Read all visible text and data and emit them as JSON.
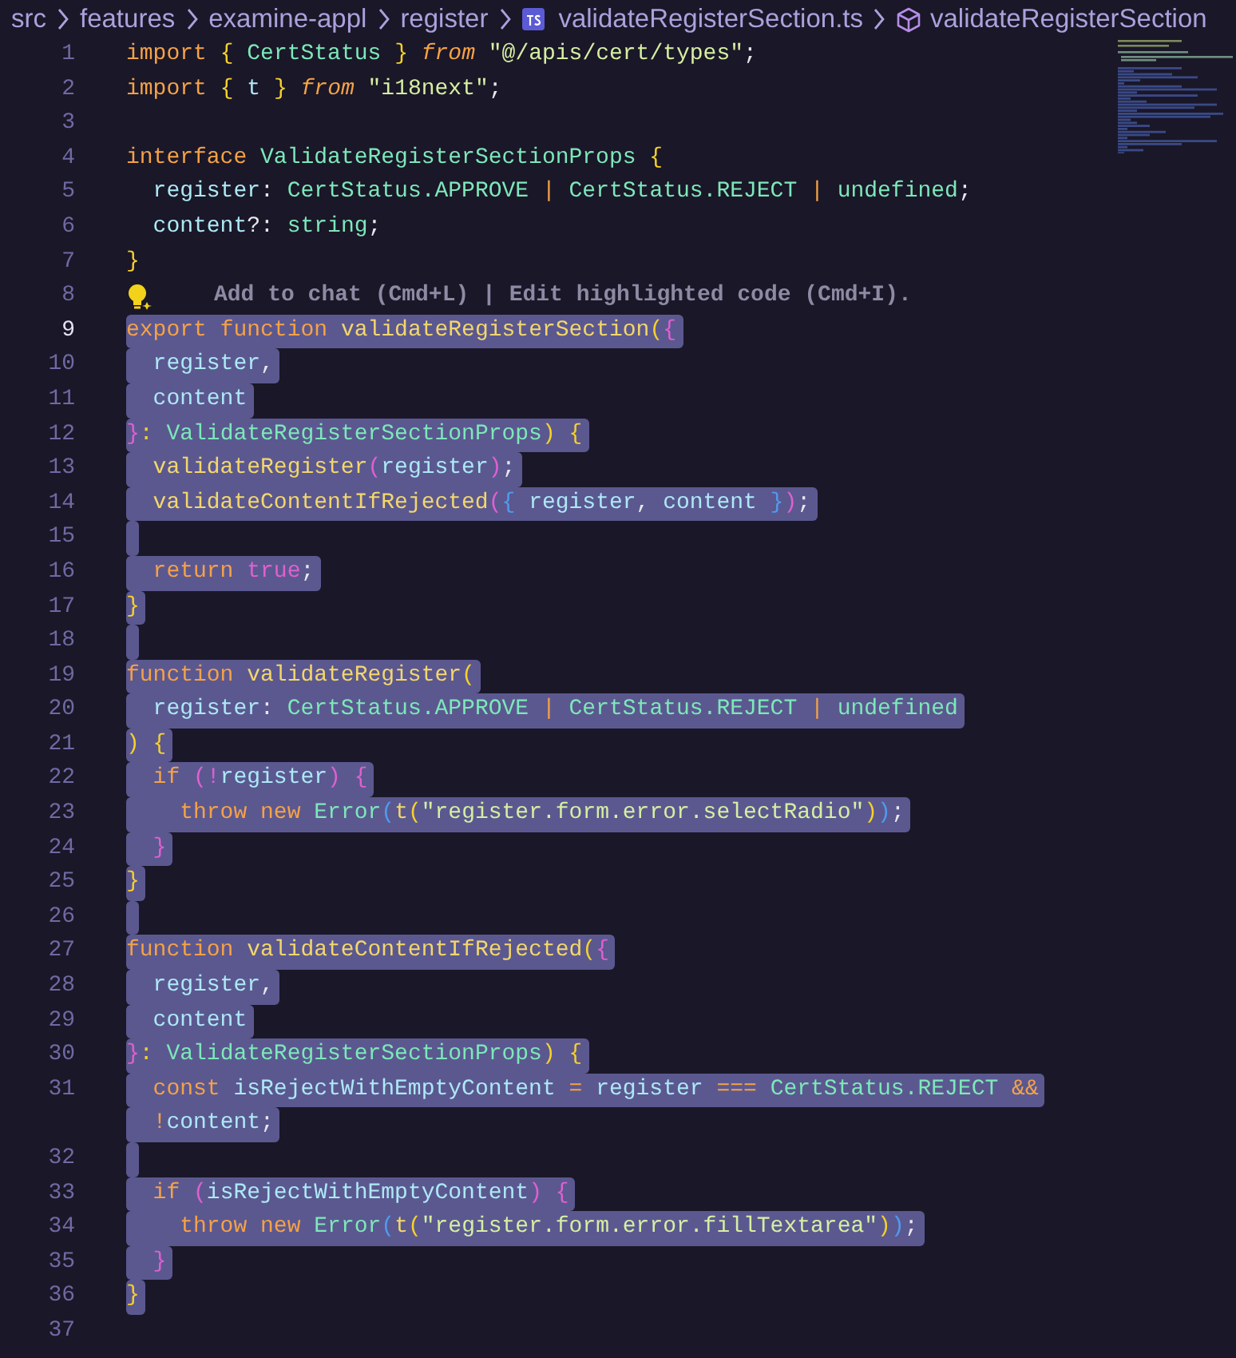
{
  "breadcrumb": [
    {
      "label": "src",
      "kind": "folder"
    },
    {
      "label": "features",
      "kind": "folder"
    },
    {
      "label": "examine-appl",
      "kind": "folder"
    },
    {
      "label": "register",
      "kind": "folder"
    },
    {
      "label": "validateRegisterSection.ts",
      "kind": "file"
    },
    {
      "label": "validateRegisterSection",
      "kind": "symbol"
    }
  ],
  "lines": [
    {
      "number": "1",
      "selected": false,
      "tokens": [
        {
          "t": "import",
          "kind": "kw"
        },
        {
          "t": " {",
          "kind": "b"
        },
        {
          "t": " CertStatus ",
          "kind": "ty"
        },
        {
          "t": "} ",
          "kind": "b"
        },
        {
          "t": "from",
          "kind": "ki"
        },
        {
          "t": " \"@/apis/cert/types\"",
          "kind": "s"
        },
        {
          "t": ";",
          "kind": "p"
        }
      ]
    },
    {
      "number": "2",
      "selected": false,
      "tokens": [
        {
          "t": "import",
          "kind": "kw"
        },
        {
          "t": " { ",
          "kind": "b"
        },
        {
          "t": "t",
          "kind": "v"
        },
        {
          "t": " } ",
          "kind": "b"
        },
        {
          "t": "from",
          "kind": "ki"
        },
        {
          "t": " \"i18next\"",
          "kind": "s"
        },
        {
          "t": ";",
          "kind": "p"
        }
      ]
    },
    {
      "number": "3",
      "selected": false
    },
    {
      "number": "4",
      "selected": false,
      "tokens": [
        {
          "t": "interface",
          "kind": "kw"
        },
        {
          "t": " ValidateRegisterSectionProps",
          "kind": "ty"
        },
        {
          "t": " {",
          "kind": "b"
        }
      ]
    },
    {
      "number": "5",
      "selected": false,
      "tokens": [
        {
          "t": "  register",
          "kind": "v"
        },
        {
          "t": ": ",
          "kind": "p"
        },
        {
          "t": "CertStatus.APPROVE",
          "kind": "ty"
        },
        {
          "t": " | ",
          "kind": "o"
        },
        {
          "t": "CertStatus.REJECT",
          "kind": "ty"
        },
        {
          "t": " | ",
          "kind": "o"
        },
        {
          "t": "undefined",
          "kind": "ty"
        },
        {
          "t": ";",
          "kind": "p"
        }
      ]
    },
    {
      "number": "6",
      "selected": false,
      "tokens": [
        {
          "t": "  content",
          "kind": "v"
        },
        {
          "t": "?: ",
          "kind": "p"
        },
        {
          "t": "string",
          "kind": "ty"
        },
        {
          "t": ";",
          "kind": "p"
        }
      ]
    },
    {
      "number": "7",
      "selected": false,
      "tokens": [
        {
          "t": "}",
          "kind": "b"
        }
      ]
    },
    {
      "number": "8",
      "selected": false,
      "hint": "Add to chat (Cmd+L) | Edit highlighted code (Cmd+I)."
    },
    {
      "number": "9",
      "selected": true,
      "tokens": [
        {
          "t": "export",
          "kind": "kw"
        },
        {
          "t": " function",
          "kind": "kw"
        },
        {
          "t": " validateRegisterSection",
          "kind": "f"
        },
        {
          "t": "(",
          "kind": "b"
        },
        {
          "t": "{",
          "kind": "m"
        }
      ]
    },
    {
      "number": "10",
      "selected": true,
      "tokens": [
        {
          "t": "  register",
          "kind": "v"
        },
        {
          "t": ",",
          "kind": "p"
        }
      ]
    },
    {
      "number": "11",
      "selected": true,
      "tokens": [
        {
          "t": "  content",
          "kind": "v"
        }
      ]
    },
    {
      "number": "12",
      "selected": true,
      "tokens": [
        {
          "t": "}",
          "kind": "m"
        },
        {
          "t": ": ",
          "kind": "b"
        },
        {
          "t": "ValidateRegisterSectionProps",
          "kind": "ty"
        },
        {
          "t": ")",
          "kind": "b"
        },
        {
          "t": " {",
          "kind": "b"
        }
      ]
    },
    {
      "number": "13",
      "selected": true,
      "tokens": [
        {
          "t": "  validateRegister",
          "kind": "f"
        },
        {
          "t": "(",
          "kind": "m"
        },
        {
          "t": "register",
          "kind": "v"
        },
        {
          "t": ")",
          "kind": "m"
        },
        {
          "t": ";",
          "kind": "p"
        }
      ]
    },
    {
      "number": "14",
      "selected": true,
      "tokens": [
        {
          "t": "  validateContentIfRejected",
          "kind": "f"
        },
        {
          "t": "(",
          "kind": "m"
        },
        {
          "t": "{ ",
          "kind": "bl"
        },
        {
          "t": "register",
          "kind": "v"
        },
        {
          "t": ", ",
          "kind": "p"
        },
        {
          "t": "content",
          "kind": "v"
        },
        {
          "t": " }",
          "kind": "bl"
        },
        {
          "t": ")",
          "kind": "m"
        },
        {
          "t": ";",
          "kind": "p"
        }
      ]
    },
    {
      "number": "15",
      "selected": true
    },
    {
      "number": "16",
      "selected": true,
      "tokens": [
        {
          "t": "  return",
          "kind": "kw"
        },
        {
          "t": " true",
          "kind": "m"
        },
        {
          "t": ";",
          "kind": "p"
        }
      ]
    },
    {
      "number": "17",
      "selected": true,
      "tokens": [
        {
          "t": "}",
          "kind": "b"
        }
      ]
    },
    {
      "number": "18",
      "selected": true
    },
    {
      "number": "19",
      "selected": true,
      "tokens": [
        {
          "t": "function",
          "kind": "kw"
        },
        {
          "t": " validateRegister",
          "kind": "f"
        },
        {
          "t": "(",
          "kind": "b"
        }
      ]
    },
    {
      "number": "20",
      "selected": true,
      "tokens": [
        {
          "t": "  register",
          "kind": "v"
        },
        {
          "t": ": ",
          "kind": "p"
        },
        {
          "t": "CertStatus.APPROVE",
          "kind": "ty"
        },
        {
          "t": " | ",
          "kind": "o"
        },
        {
          "t": "CertStatus.REJECT",
          "kind": "ty"
        },
        {
          "t": " | ",
          "kind": "o"
        },
        {
          "t": "undefined",
          "kind": "ty"
        }
      ]
    },
    {
      "number": "21",
      "selected": true,
      "tokens": [
        {
          "t": ")",
          "kind": "b"
        },
        {
          "t": " {",
          "kind": "b"
        }
      ]
    },
    {
      "number": "22",
      "selected": true,
      "tokens": [
        {
          "t": "  if",
          "kind": "kw"
        },
        {
          "t": " (!",
          "kind": "m"
        },
        {
          "t": "register",
          "kind": "v"
        },
        {
          "t": ")",
          "kind": "m"
        },
        {
          "t": " {",
          "kind": "m"
        }
      ]
    },
    {
      "number": "23",
      "selected": true,
      "tokens": [
        {
          "t": "    throw",
          "kind": "kw"
        },
        {
          "t": " new",
          "kind": "kw"
        },
        {
          "t": " Error",
          "kind": "ty"
        },
        {
          "t": "(",
          "kind": "bl"
        },
        {
          "t": "t",
          "kind": "f"
        },
        {
          "t": "(",
          "kind": "b"
        },
        {
          "t": "\"register.form.error.selectRadio\"",
          "kind": "s"
        },
        {
          "t": ")",
          "kind": "b"
        },
        {
          "t": ")",
          "kind": "bl"
        },
        {
          "t": ";",
          "kind": "p"
        }
      ]
    },
    {
      "number": "24",
      "selected": true,
      "tokens": [
        {
          "t": "  }",
          "kind": "m"
        }
      ]
    },
    {
      "number": "25",
      "selected": true,
      "tokens": [
        {
          "t": "}",
          "kind": "b"
        }
      ]
    },
    {
      "number": "26",
      "selected": true
    },
    {
      "number": "27",
      "selected": true,
      "tokens": [
        {
          "t": "function",
          "kind": "kw"
        },
        {
          "t": " validateContentIfRejected",
          "kind": "f"
        },
        {
          "t": "(",
          "kind": "b"
        },
        {
          "t": "{",
          "kind": "m"
        }
      ]
    },
    {
      "number": "28",
      "selected": true,
      "tokens": [
        {
          "t": "  register",
          "kind": "v"
        },
        {
          "t": ",",
          "kind": "p"
        }
      ]
    },
    {
      "number": "29",
      "selected": true,
      "tokens": [
        {
          "t": "  content",
          "kind": "v"
        }
      ]
    },
    {
      "number": "30",
      "selected": true,
      "tokens": [
        {
          "t": "}",
          "kind": "m"
        },
        {
          "t": ": ",
          "kind": "b"
        },
        {
          "t": "ValidateRegisterSectionProps",
          "kind": "ty"
        },
        {
          "t": ")",
          "kind": "b"
        },
        {
          "t": " {",
          "kind": "b"
        }
      ]
    },
    {
      "number": "31",
      "selected": true,
      "tokens": [
        {
          "t": "  const",
          "kind": "kw"
        },
        {
          "t": " isRejectWithEmptyContent",
          "kind": "v"
        },
        {
          "t": " = ",
          "kind": "o"
        },
        {
          "t": "register",
          "kind": "v"
        },
        {
          "t": " === ",
          "kind": "o"
        },
        {
          "t": "CertStatus.REJECT",
          "kind": "ty"
        },
        {
          "t": " &&",
          "kind": "o"
        }
      ],
      "wrapped": [
        {
          "t": "  !",
          "kind": "o"
        },
        {
          "t": "content",
          "kind": "v"
        },
        {
          "t": ";",
          "kind": "p"
        }
      ]
    },
    {
      "number": "32",
      "selected": true
    },
    {
      "number": "33",
      "selected": true,
      "tokens": [
        {
          "t": "  if",
          "kind": "kw"
        },
        {
          "t": " (",
          "kind": "m"
        },
        {
          "t": "isRejectWithEmptyContent",
          "kind": "v"
        },
        {
          "t": ")",
          "kind": "m"
        },
        {
          "t": " {",
          "kind": "m"
        }
      ]
    },
    {
      "number": "34",
      "selected": true,
      "tokens": [
        {
          "t": "    throw",
          "kind": "kw"
        },
        {
          "t": " new",
          "kind": "kw"
        },
        {
          "t": " Error",
          "kind": "ty"
        },
        {
          "t": "(",
          "kind": "bl"
        },
        {
          "t": "t",
          "kind": "f"
        },
        {
          "t": "(",
          "kind": "b"
        },
        {
          "t": "\"register.form.error.fillTextarea\"",
          "kind": "s"
        },
        {
          "t": ")",
          "kind": "b"
        },
        {
          "t": ")",
          "kind": "bl"
        },
        {
          "t": ";",
          "kind": "p"
        }
      ]
    },
    {
      "number": "35",
      "selected": true,
      "tokens": [
        {
          "t": "  }",
          "kind": "m"
        }
      ]
    },
    {
      "number": "36",
      "selected": true,
      "tokens": [
        {
          "t": "}",
          "kind": "b"
        }
      ]
    },
    {
      "number": "37",
      "selected": false
    }
  ]
}
